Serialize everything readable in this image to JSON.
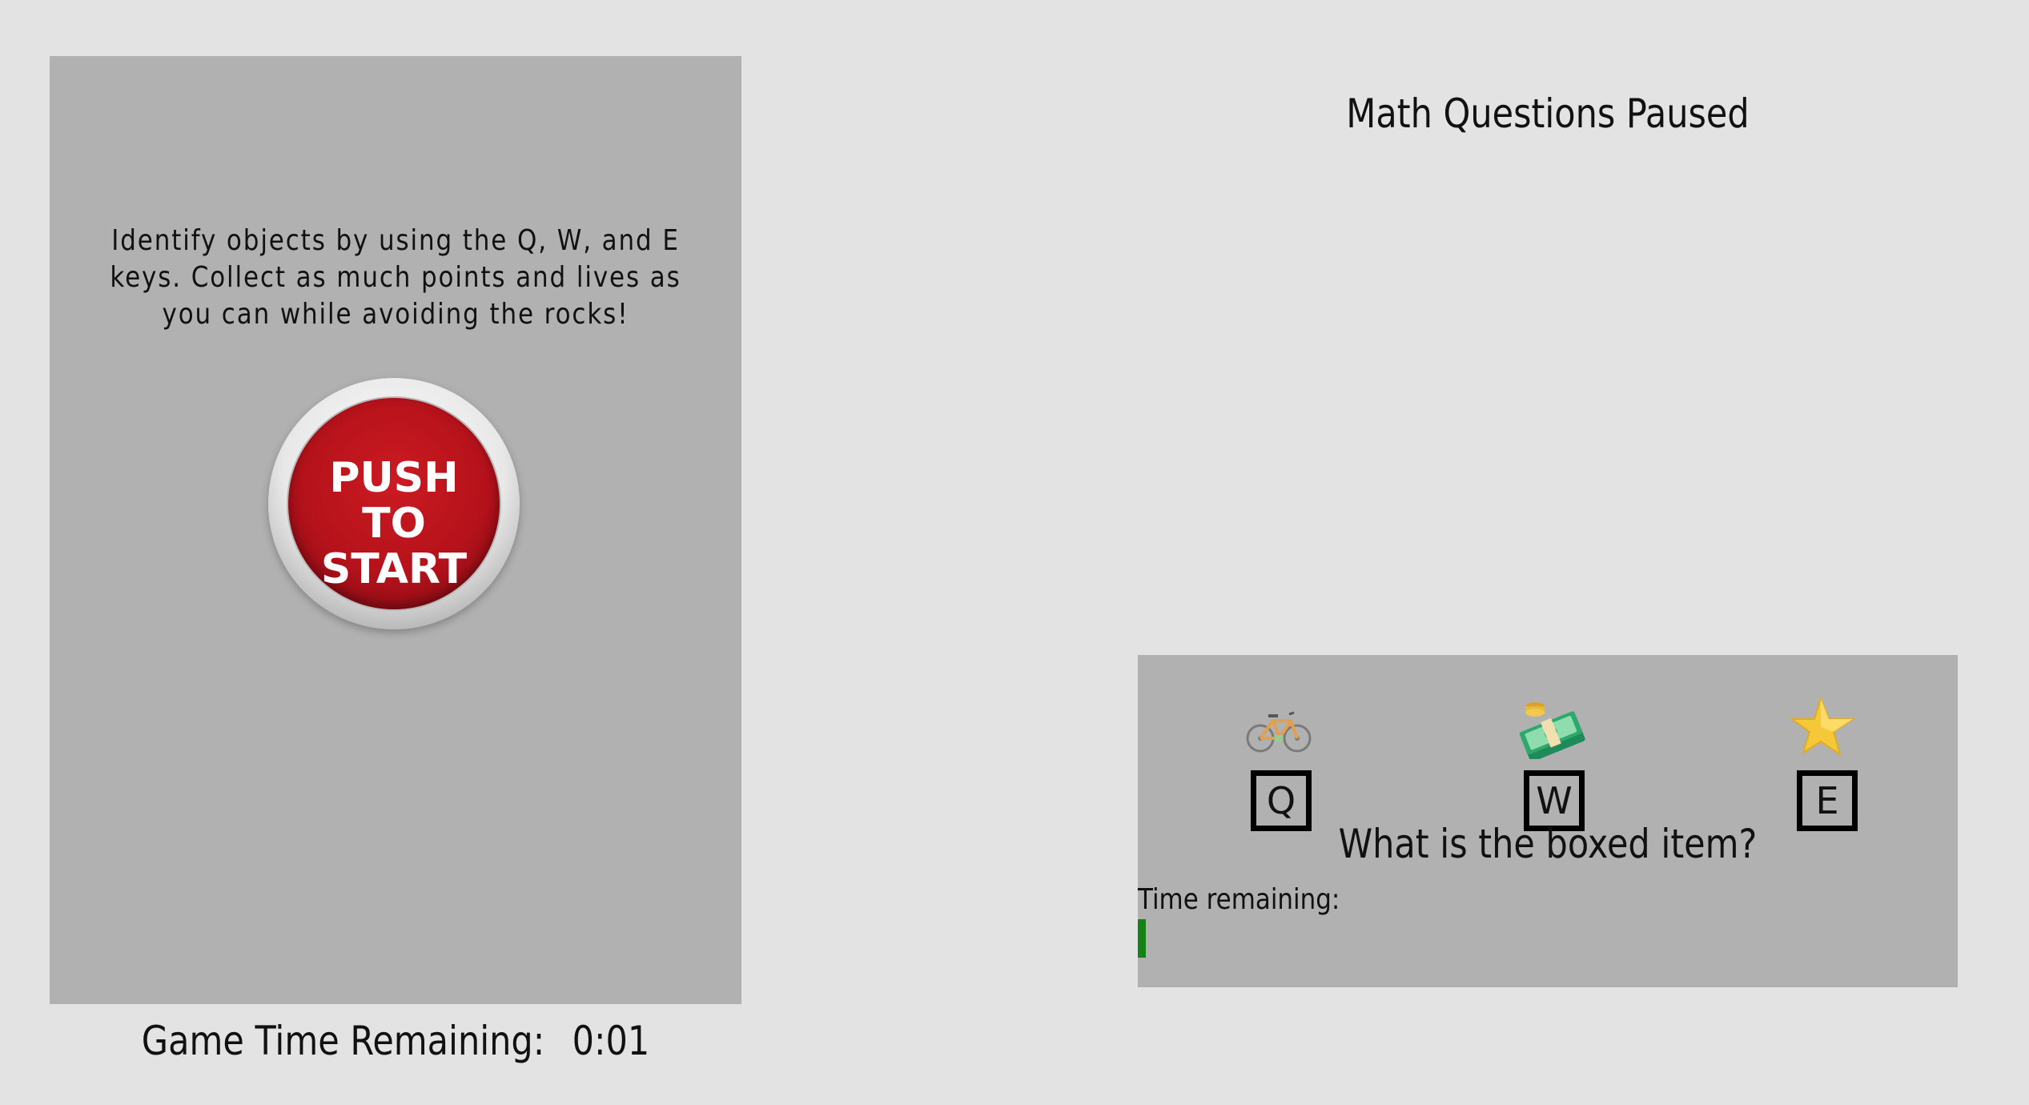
{
  "game": {
    "instructions": [
      "Identify objects by using the Q, W, and E",
      "keys. Collect as much points and lives as",
      "you can while avoiding the rocks!"
    ],
    "start_button": [
      "PUSH",
      "TO",
      "START"
    ],
    "time_label": "Game Time Remaining:",
    "time_value": "0:01"
  },
  "math": {
    "status": "Math Questions Paused"
  },
  "question": {
    "options": [
      {
        "key": "Q",
        "icon": "bicycle-icon"
      },
      {
        "key": "W",
        "icon": "money-icon"
      },
      {
        "key": "E",
        "icon": "star-icon"
      }
    ],
    "prompt": "What is the boxed item?",
    "time_label": "Time remaining:",
    "time_fraction": 0.01,
    "time_bar_color": "#148214"
  },
  "colors": {
    "background": "#e3e3e3",
    "panel": "#b1b1b1",
    "button_red": "#b5121b"
  }
}
